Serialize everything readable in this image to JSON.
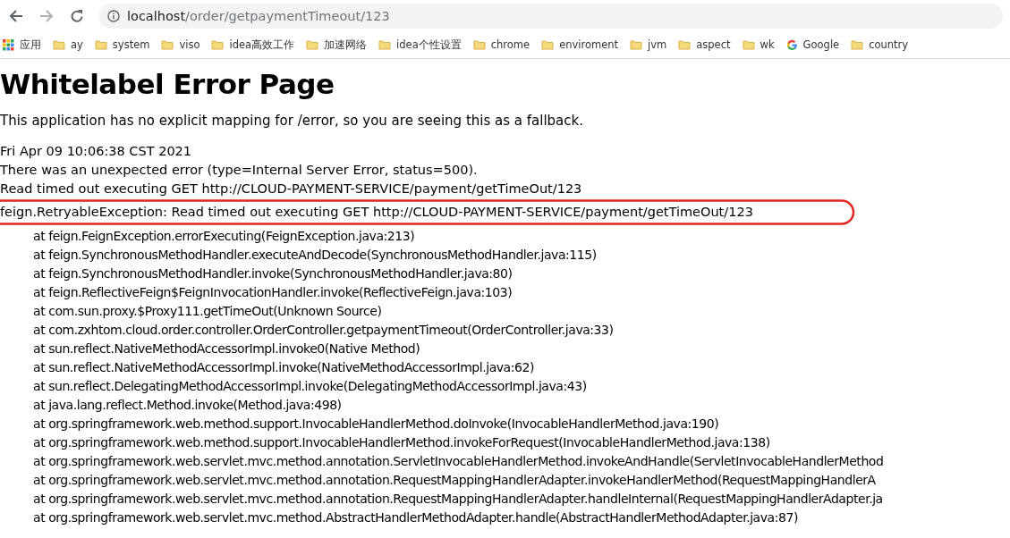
{
  "browser": {
    "url_host": "localhost",
    "url_path": "/order/getpaymentTimeout/123"
  },
  "bookmarks": [
    {
      "label": "应用",
      "kind": "apps"
    },
    {
      "label": "ay",
      "kind": "folder"
    },
    {
      "label": "system",
      "kind": "folder"
    },
    {
      "label": "viso",
      "kind": "folder"
    },
    {
      "label": "idea高效工作",
      "kind": "folder"
    },
    {
      "label": "加速网络",
      "kind": "folder"
    },
    {
      "label": "idea个性设置",
      "kind": "folder"
    },
    {
      "label": "chrome",
      "kind": "folder"
    },
    {
      "label": "enviroment",
      "kind": "folder"
    },
    {
      "label": "jvm",
      "kind": "folder"
    },
    {
      "label": "aspect",
      "kind": "folder"
    },
    {
      "label": "wk",
      "kind": "folder"
    },
    {
      "label": "Google",
      "kind": "google"
    },
    {
      "label": "country",
      "kind": "folder"
    }
  ],
  "page": {
    "title": "Whitelabel Error Page",
    "intro": "This application has no explicit mapping for /error, so you are seeing this as a fallback.",
    "lines": [
      {
        "text": "Fri Apr 09 10:06:38 CST 2021",
        "circled": false
      },
      {
        "text": "There was an unexpected error (type=Internal Server Error, status=500).",
        "circled": false
      },
      {
        "text": "Read timed out executing GET http://CLOUD-PAYMENT-SERVICE/payment/getTimeOut/123",
        "circled": false
      },
      {
        "text": "feign.RetryableException: Read timed out executing GET http://CLOUD-PAYMENT-SERVICE/payment/getTimeOut/123",
        "circled": true
      }
    ],
    "stack": [
      "at feign.FeignException.errorExecuting(FeignException.java:213)",
      "at feign.SynchronousMethodHandler.executeAndDecode(SynchronousMethodHandler.java:115)",
      "at feign.SynchronousMethodHandler.invoke(SynchronousMethodHandler.java:80)",
      "at feign.ReflectiveFeign$FeignInvocationHandler.invoke(ReflectiveFeign.java:103)",
      "at com.sun.proxy.$Proxy111.getTimeOut(Unknown Source)",
      "at com.zxhtom.cloud.order.controller.OrderController.getpaymentTimeout(OrderController.java:33)",
      "at sun.reflect.NativeMethodAccessorImpl.invoke0(Native Method)",
      "at sun.reflect.NativeMethodAccessorImpl.invoke(NativeMethodAccessorImpl.java:62)",
      "at sun.reflect.DelegatingMethodAccessorImpl.invoke(DelegatingMethodAccessorImpl.java:43)",
      "at java.lang.reflect.Method.invoke(Method.java:498)",
      "at org.springframework.web.method.support.InvocableHandlerMethod.doInvoke(InvocableHandlerMethod.java:190)",
      "at org.springframework.web.method.support.InvocableHandlerMethod.invokeForRequest(InvocableHandlerMethod.java:138)",
      "at org.springframework.web.servlet.mvc.method.annotation.ServletInvocableHandlerMethod.invokeAndHandle(ServletInvocableHandlerMethod",
      "at org.springframework.web.servlet.mvc.method.annotation.RequestMappingHandlerAdapter.invokeHandlerMethod(RequestMappingHandlerA",
      "at org.springframework.web.servlet.mvc.method.annotation.RequestMappingHandlerAdapter.handleInternal(RequestMappingHandlerAdapter.ja",
      "at org.springframework.web.servlet.mvc.method.AbstractHandlerMethodAdapter.handle(AbstractHandlerMethodAdapter.java:87)"
    ]
  }
}
